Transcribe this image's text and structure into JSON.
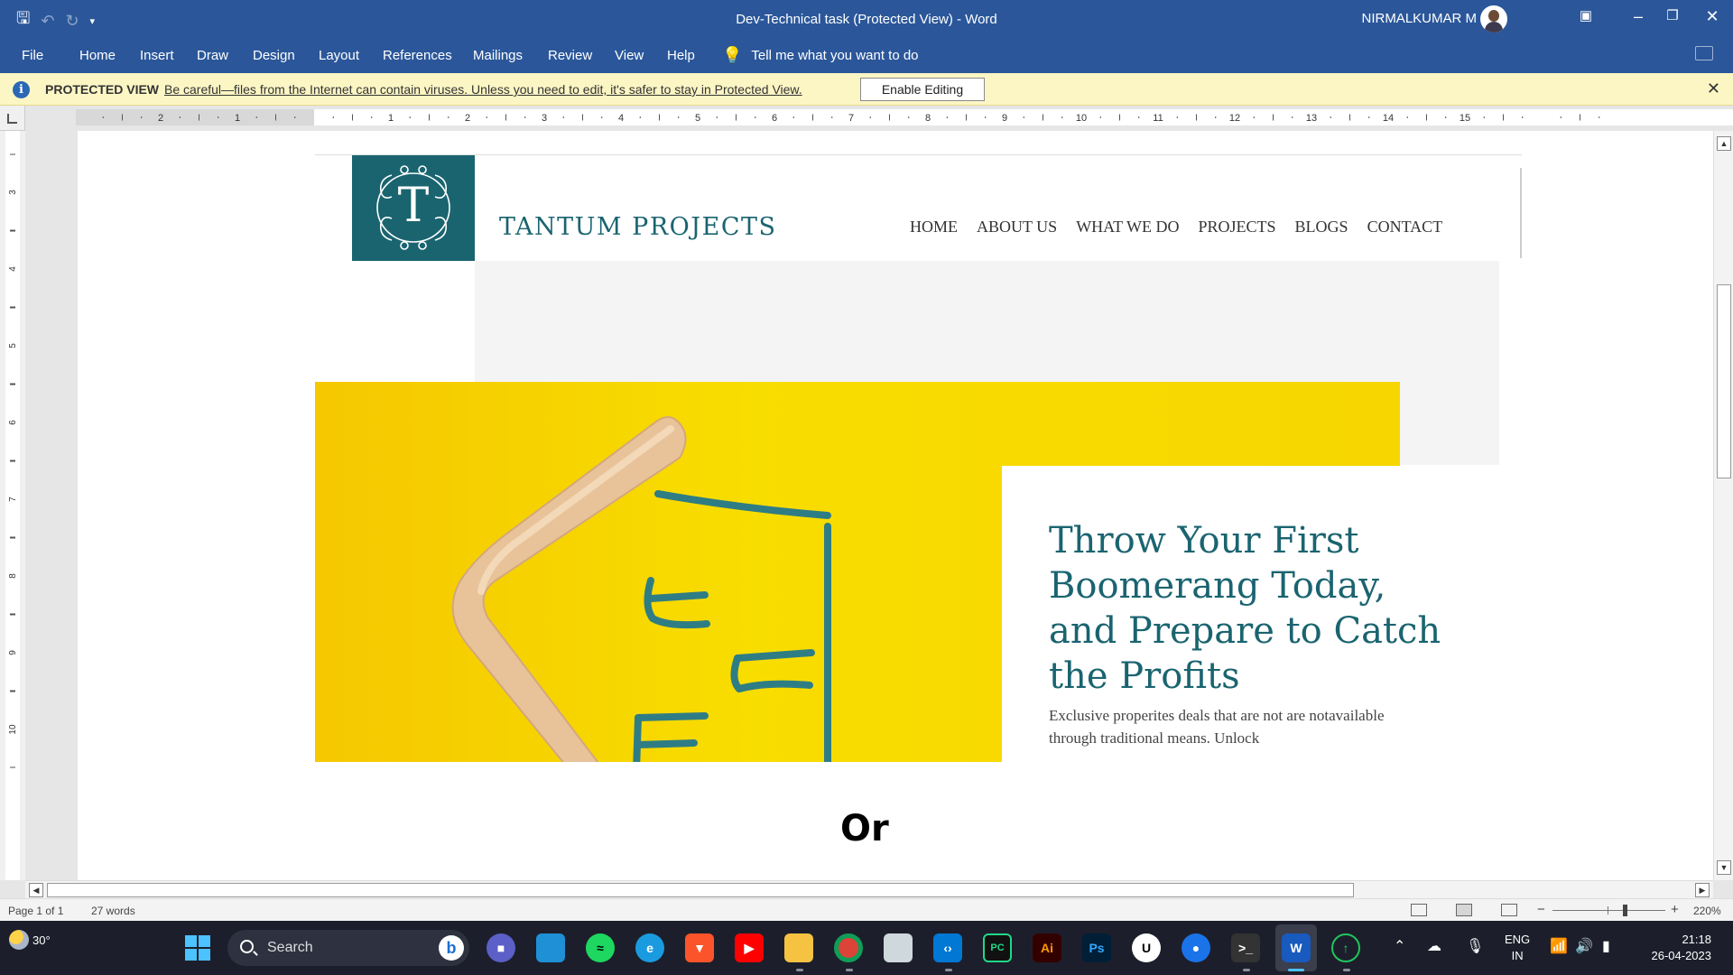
{
  "window": {
    "title": "Dev-Technical task (Protected View)  -  Word",
    "user_name": "NIRMALKUMAR M"
  },
  "ribbon": {
    "file": "File",
    "tabs": [
      "Home",
      "Insert",
      "Draw",
      "Design",
      "Layout",
      "References",
      "Mailings",
      "Review",
      "View",
      "Help"
    ],
    "tell_me": "Tell me what you want to do"
  },
  "protected_view": {
    "label": "PROTECTED VIEW",
    "message": "Be careful—files from the Internet can contain viruses. Unless you need to edit, it's safer to stay in Protected View.",
    "enable_button": "Enable Editing"
  },
  "ruler": {
    "left_numbers": [
      "2",
      "1"
    ],
    "right_numbers": [
      "1",
      "2",
      "3",
      "4",
      "5",
      "6",
      "7",
      "8",
      "9",
      "10",
      "11",
      "12",
      "13",
      "14",
      "15"
    ],
    "vertical_numbers": [
      "3",
      "4",
      "5",
      "6",
      "7",
      "8",
      "9",
      "10"
    ]
  },
  "document": {
    "embedded_site": {
      "logo_letter": "T",
      "brand": "TANTUM PROJECTS",
      "nav": [
        "HOME",
        "ABOUT US",
        "WHAT WE DO",
        "PROJECTS",
        "BLOGS",
        "CONTACT"
      ],
      "headline": "Throw Your First Boomerang Today, and Prepare to Catch the Profits",
      "subtext": "Exclusive properites deals that are not are notavailable through traditional means. Unlock"
    },
    "body_text": "Or"
  },
  "status_bar": {
    "page": "Page 1 of 1",
    "words": "27 words",
    "zoom": "220%",
    "zoom_level": 2.2
  },
  "taskbar": {
    "weather_temp": "30°",
    "search_placeholder": "Search",
    "language_line1": "ENG",
    "language_line2": "IN",
    "time": "21:18",
    "date": "26-04-2023"
  },
  "colors": {
    "word_blue": "#2b579a",
    "protected_bar": "#fcf6c4",
    "brand_teal": "#1a6470",
    "hero_yellow": "#f7d600",
    "taskbar": "#1c1f2b"
  }
}
